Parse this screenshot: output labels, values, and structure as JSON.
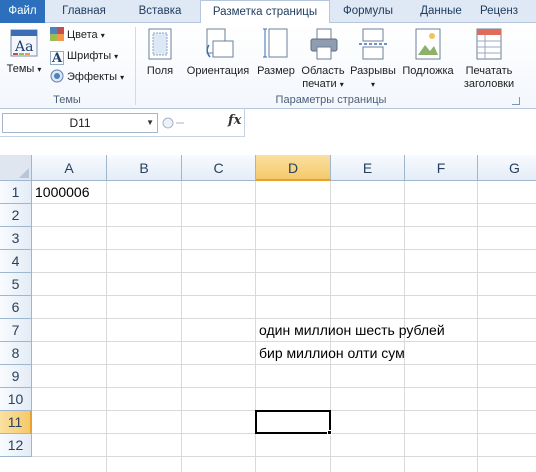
{
  "tabs": [
    {
      "label": "Файл"
    },
    {
      "label": "Главная"
    },
    {
      "label": "Вставка"
    },
    {
      "label": "Разметка страницы"
    },
    {
      "label": "Формулы"
    },
    {
      "label": "Данные"
    },
    {
      "label": "Реценз"
    }
  ],
  "ribbon": {
    "themes": {
      "button_label": "Темы",
      "colors_label": "Цвета",
      "fonts_label": "Шрифты",
      "effects_label": "Эффекты",
      "group_caption": "Темы"
    },
    "page_setup": {
      "group_caption": "Параметры страницы",
      "margins_label": "Поля",
      "orientation_label": "Ориентация",
      "size_label": "Размер",
      "print_area_label_1": "Область",
      "print_area_label_2": "печати",
      "breaks_label": "Разрывы",
      "background_label": "Подложка",
      "print_titles_label_1": "Печатать",
      "print_titles_label_2": "заголовки"
    }
  },
  "formula_bar": {
    "name_box": "D11",
    "fx_label": "fx",
    "formula": ""
  },
  "sheet": {
    "columns": [
      "A",
      "B",
      "C",
      "D",
      "E",
      "F",
      "G"
    ],
    "rows": [
      "1",
      "2",
      "3",
      "4",
      "5",
      "6",
      "7",
      "8",
      "9",
      "10",
      "11",
      "12"
    ],
    "selected_column": "D",
    "selected_row": "11",
    "cells": {
      "A1": "1000006",
      "D7": "один миллион шесть рублей",
      "D8": "бир миллион олти сум"
    }
  },
  "colors": {
    "file_tab": "#2c6fbc",
    "selection_header": "#f5c96a",
    "gridline": "#d9d9d9"
  }
}
